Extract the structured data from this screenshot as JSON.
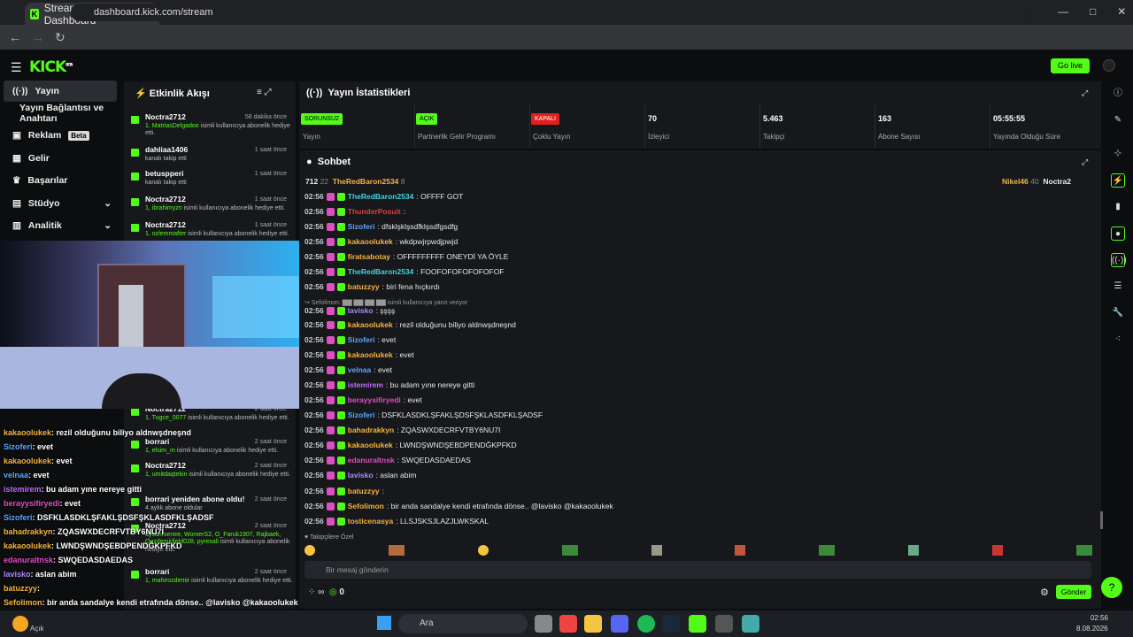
{
  "browser": {
    "tab_title": "Stream - Kick Dashboard",
    "url": "dashboard.kick.com/stream"
  },
  "header": {
    "logo": "KICK",
    "logo_sup": "BETA",
    "go_live": "Go live"
  },
  "nav": [
    {
      "label": "Yayın",
      "icon": "broadcast-icon"
    },
    {
      "label": "Yayın Bağlantısı ve Anahtarı",
      "icon": ""
    },
    {
      "label": "Reklam",
      "icon": "ad-icon",
      "badge": "Beta"
    },
    {
      "label": "Gelir",
      "icon": "wallet-icon"
    },
    {
      "label": "Başarılar",
      "icon": "trophy-icon"
    },
    {
      "label": "Stüdyo",
      "icon": "studio-icon"
    },
    {
      "label": "Analitik",
      "icon": "chart-icon"
    }
  ],
  "activity": {
    "title": "Etkinlik Akışı",
    "items": [
      {
        "name": "Noctra2712",
        "time": "58 dakika önce",
        "prefix": "1, MatriasDelgadoo",
        "desc": " isimli kullanıcıya abonelik hediye etti."
      },
      {
        "name": "dahliaa1406",
        "time": "1 saat önce",
        "prefix": "",
        "desc": "kanalı takip etti"
      },
      {
        "name": "betuspperi",
        "time": "1 saat önce",
        "prefix": "",
        "desc": "kanalı takip etti"
      },
      {
        "name": "Noctra2712",
        "time": "1 saat önce",
        "prefix": "1, ibrahimyzn",
        "desc": " isimli kullanıcıya abonelik hediye etti."
      },
      {
        "name": "Noctra2712",
        "time": "1 saat önce",
        "prefix": "1, ozlemmafter",
        "desc": " isimli kullanıcıya abonelik hediye etti."
      },
      {
        "name": "Noctra2712",
        "time": "2 saat önce",
        "prefix": "1, Tugce_0077",
        "desc": " isimli kullanıcıya abonelik hediye etti."
      },
      {
        "name": "borrari",
        "time": "2 saat önce",
        "prefix": "1, elsim_m",
        "desc": " isimli kullanıcıya abonelik hediye etti."
      },
      {
        "name": "Noctra2712",
        "time": "2 saat önce",
        "prefix": "1, umitdaqtekin",
        "desc": " isimli kullanıcıya abonelik hediye etti."
      },
      {
        "name": "borrari yeniden abone oldu!",
        "time": "2 saat önce",
        "prefix": "",
        "desc": "4 aylık abone oldular"
      },
      {
        "name": "Noctra2712",
        "time": "2 saat önce",
        "prefix": "aycanrsenee, WomerS2, O_Faruk1907, Rajbaek, Oozdemirfield028, pyrexali",
        "desc": " isimli kullanıcıya abonelik hediye etti."
      },
      {
        "name": "borrari",
        "time": "2 saat önce",
        "prefix": "1, mahirozdemir",
        "desc": " isimli kullanıcıya abonelik hediye etti."
      }
    ]
  },
  "stats": {
    "title": "Yayın İstatistikleri",
    "cells": [
      {
        "tag": "SORUNSUZ",
        "tag_color": "#53fc18",
        "label": "Yayın"
      },
      {
        "tag": "AÇIK",
        "tag_color": "#53fc18",
        "label": "Partnerlik Gelir Programı"
      },
      {
        "tag": "KAPALI",
        "tag_color": "#e02020",
        "label": "Çoklu Yayın"
      },
      {
        "value": "70",
        "label": "İzleyici"
      },
      {
        "value": "5.463",
        "label": "Takipçi"
      },
      {
        "value": "163",
        "label": "Abone Sayısı"
      },
      {
        "value": "05:55:55",
        "label": "Yayında Olduğu Süre"
      }
    ]
  },
  "chat": {
    "title": "Sohbet",
    "top": {
      "count": "712",
      "count2": "22",
      "user1": "TheRedBaron2534",
      "n1": "8",
      "user2": "Nikel46",
      "n2": "40",
      "user3": "Noctra2"
    },
    "messages": [
      {
        "time": "02:56",
        "user": "TheRedBaron2534",
        "color": "#3fd4e0",
        "text": ": OFFFF GOT"
      },
      {
        "time": "02:56",
        "user": "ThunderPosuit",
        "color": "#e83a3a",
        "text": ":"
      },
      {
        "time": "02:56",
        "user": "Sizoferi",
        "color": "#5aa6ff",
        "text": ": dfsklşklşsdfklşsdfgsdfg"
      },
      {
        "time": "02:56",
        "user": "kakaoolukek",
        "color": "#f5b342",
        "text": ": wkdpwjrpwdjpwjd"
      },
      {
        "time": "02:56",
        "user": "firatsabotay",
        "color": "#f5b342",
        "text": ": OFFFFFFFFF ONEYDİ YA ÖYLE"
      },
      {
        "time": "02:56",
        "user": "TheRedBaron2534",
        "color": "#3fd4e0",
        "text": ": FOOFOFOFOFOFOFOF"
      },
      {
        "time": "02:56",
        "user": "batuzzyy",
        "color": "#f5b342",
        "text": ": biri fena hıçkırdı"
      },
      {
        "time": "02:56",
        "user": "lavisko",
        "color": "#a98bff",
        "text": ": şşşş"
      },
      {
        "time": "02:56",
        "user": "kakaoolukek",
        "color": "#f5b342",
        "text": ": rezil olduğunu biliyo aldnwşdneşnd"
      },
      {
        "time": "02:56",
        "user": "Sizoferi",
        "color": "#5aa6ff",
        "text": ": evet"
      },
      {
        "time": "02:56",
        "user": "kakaoolukek",
        "color": "#f5b342",
        "text": ": evet"
      },
      {
        "time": "02:56",
        "user": "velnaa",
        "color": "#5aa6ff",
        "text": ": evet"
      },
      {
        "time": "02:56",
        "user": "istemirem",
        "color": "#c06bff",
        "text": ": bu adam yıne nereye gitti"
      },
      {
        "time": "02:56",
        "user": "berayysifiryedi",
        "color": "#e04ec4",
        "text": ": evet"
      },
      {
        "time": "02:56",
        "user": "Sizoferi",
        "color": "#5aa6ff",
        "text": ": DSFKLASDKLŞFAKLŞDSFŞKLASDFKLŞADSF"
      },
      {
        "time": "02:56",
        "user": "bahadrakkyn",
        "color": "#f5b342",
        "text": ": ZQASWXDECRFVTBY6NU7I"
      },
      {
        "time": "02:56",
        "user": "kakaoolukek",
        "color": "#f5b342",
        "text": ": LWNDŞWNDŞEBDPENDĞKPFKD"
      },
      {
        "time": "02:56",
        "user": "edanuraltnsk",
        "color": "#e04ec4",
        "text": ": SWQEDASDAEDAS"
      },
      {
        "time": "02:56",
        "user": "lavisko",
        "color": "#a98bff",
        "text": ": aslan abim"
      },
      {
        "time": "02:56",
        "user": "batuzzyy",
        "color": "#f5b342",
        "text": ":"
      },
      {
        "time": "02:56",
        "user": "Sefolimon",
        "color": "#f5b342",
        "text": ": bir anda sandalye kendi etrafında dönse.. @lavisko @kakaoolukek"
      },
      {
        "time": "02:56",
        "user": "tosticenasya",
        "color": "#f5b342",
        "text": ": LLSJSKSJLAZJLWKSKAL"
      }
    ],
    "reply_note": "Sefolimon:",
    "reply_suffix": "isimli kullanıcıya yanıt veriyor",
    "emote_label": "Takipçilere Özel",
    "input_placeholder": "Bir mesaj gönderin",
    "points": "0",
    "send": "Gönder"
  },
  "overlay": [
    {
      "user": "kakaoolukek",
      "color": "#f5b342",
      "text": ": rezil olduğunu biliyo aldnwşdneşnd"
    },
    {
      "user": "Sizoferi",
      "color": "#5aa6ff",
      "text": ": evet"
    },
    {
      "user": "kakaoolukek",
      "color": "#f5b342",
      "text": ": evet"
    },
    {
      "user": "velnaa",
      "color": "#5aa6ff",
      "text": ": evet"
    },
    {
      "user": "istemirem",
      "color": "#c06bff",
      "text": ": bu adam yıne nereye gitti"
    },
    {
      "user": "berayysifiryedi",
      "color": "#e04ec4",
      "text": ": evet"
    },
    {
      "user": "Sizoferi",
      "color": "#5aa6ff",
      "text": ": DSFKLASDKLŞFAKLŞDSFŞKLASDFKLŞADSF"
    },
    {
      "user": "bahadrakkyn",
      "color": "#f5b342",
      "text": ": ZQASWXDECRFVTBY6NU7I"
    },
    {
      "user": "kakaoolukek",
      "color": "#f5b342",
      "text": ": LWNDŞWNDŞEBDPENDĞKPFKD"
    },
    {
      "user": "edanuraltnsk",
      "color": "#e04ec4",
      "text": ": SWQEDASDAEDAS"
    },
    {
      "user": "lavisko",
      "color": "#a98bff",
      "text": ": aslan abim"
    },
    {
      "user": "batuzzyy",
      "color": "#f5b342",
      "text": ":"
    },
    {
      "user": "Sefolimon",
      "color": "#f5b342",
      "text": ": bir anda sandalye kendi etrafında dönse.. @lavisko @kakaoolukek"
    },
    {
      "user": "tosticenasya",
      "color": "#f5b342",
      "text": ": LLSJSKSJLAZJLWKSKAL"
    }
  ],
  "taskbar": {
    "search": "Ara",
    "weather": "Açık",
    "time": "02:56",
    "date": "8.08.2026"
  }
}
